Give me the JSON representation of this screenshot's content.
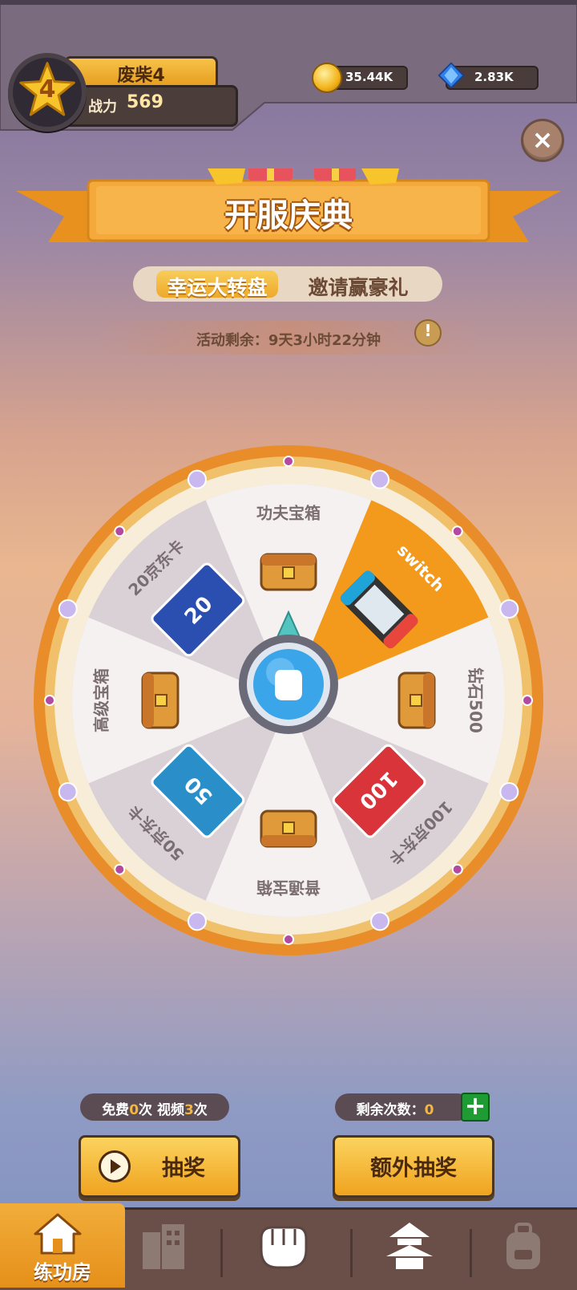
{
  "player": {
    "level": "4",
    "name": "废柴4",
    "power_label": "战力",
    "power_value": "569"
  },
  "resources": {
    "coins": "35.44K",
    "gems": "2.83K"
  },
  "banner": {
    "title": "开服庆典"
  },
  "tabs": [
    {
      "label": "幸运大转盘",
      "active": true
    },
    {
      "label": "邀请赢豪礼",
      "active": false
    }
  ],
  "timer": {
    "text": "活动剩余：9天3小时22分钟"
  },
  "wheel": {
    "segments": [
      {
        "label": "功夫宝箱",
        "icon": "kungfu-chest-icon",
        "highlighted": false
      },
      {
        "label": "switch",
        "icon": "switch-console-icon",
        "highlighted": true
      },
      {
        "label": "钻石500",
        "icon": "diamond-chest-icon",
        "highlighted": false
      },
      {
        "label": "100京东卡",
        "icon": "jd-card-100-icon",
        "highlighted": false
      },
      {
        "label": "普通宝箱",
        "icon": "normal-chest-icon",
        "highlighted": false
      },
      {
        "label": "50京东卡",
        "icon": "jd-card-50-icon",
        "highlighted": false
      },
      {
        "label": "高级宝箱",
        "icon": "advanced-chest-icon",
        "highlighted": false
      },
      {
        "label": "20京东卡",
        "icon": "jd-card-20-icon",
        "highlighted": false
      }
    ],
    "card_texts": {
      "c20": "20",
      "c50": "50",
      "c100": "100"
    }
  },
  "free_counter": {
    "prefix": "免费",
    "free": "0",
    "mid": "次 视频",
    "video": "3",
    "suffix": "次"
  },
  "remaining": {
    "label": "剩余次数：",
    "value": "0"
  },
  "buttons": {
    "draw": "抽奖",
    "extra_draw": "额外抽奖"
  },
  "nav": {
    "active_label": "练功房"
  },
  "colors": {
    "accent": "#f0a31f",
    "highlight_segment": "#f39a1c",
    "dark_panel": "#4a3c3a"
  }
}
